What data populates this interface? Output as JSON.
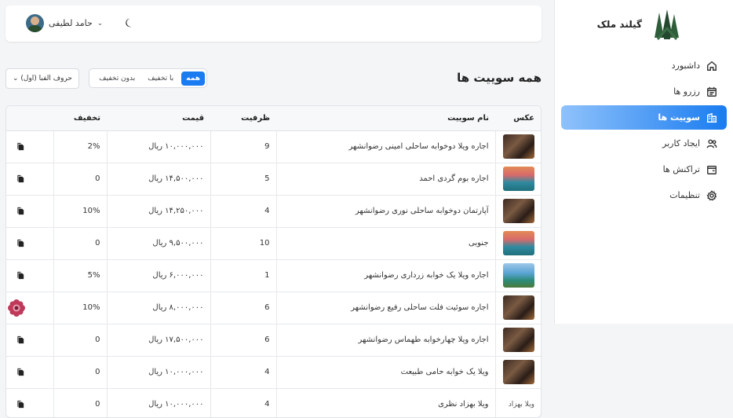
{
  "brand": {
    "name": "گیلند ملک"
  },
  "nav": [
    {
      "label": "داشبورد",
      "icon": "home-icon",
      "active": false
    },
    {
      "label": "رزرو ها",
      "icon": "calendar-icon",
      "active": false
    },
    {
      "label": "سوییت ها",
      "icon": "building-icon",
      "active": true
    },
    {
      "label": "ایجاد کاربر",
      "icon": "users-icon",
      "active": false
    },
    {
      "label": "تراکنش ها",
      "icon": "wallet-icon",
      "active": false
    },
    {
      "label": "تنظیمات",
      "icon": "gear-icon",
      "active": false
    }
  ],
  "header": {
    "user_name": "حامد لطیفی"
  },
  "page": {
    "title": "همه سوییت ها"
  },
  "filters": {
    "all": "همه",
    "with_discount": "با تخفیف",
    "no_discount": "بدون تخفیف"
  },
  "sort": {
    "selected": "حروف الفبا (اول)"
  },
  "table": {
    "headers": {
      "photo": "عکس",
      "name": "نام سوییت",
      "capacity": "ظرفیت",
      "price": "قیمت",
      "discount": "تخفیف"
    },
    "rows": [
      {
        "name": "اجاره ویلا دوخوابه ساحلی امینی رضوانشهر",
        "capacity": "9",
        "price": "۱۰,۰۰۰,۰۰۰ ریال",
        "discount": "2%",
        "img": "dark"
      },
      {
        "name": "اجاره بوم گردی احمد",
        "capacity": "5",
        "price": "۱۴,۵۰۰,۰۰۰ ریال",
        "discount": "0",
        "img": "sunset"
      },
      {
        "name": "آپارتمان دوخوابه ساحلی نوری رضوانشهر",
        "capacity": "4",
        "price": "۱۴,۲۵۰,۰۰۰ ریال",
        "discount": "10%",
        "img": "dark"
      },
      {
        "name": "جنوبی",
        "capacity": "10",
        "price": "۹,۵۰۰,۰۰۰ ریال",
        "discount": "0",
        "img": "sunset"
      },
      {
        "name": "اجاره ویلا یک خوابه زرداری رضوانشهر",
        "capacity": "1",
        "price": "۶,۰۰۰,۰۰۰ ریال",
        "discount": "5%",
        "img": "beach"
      },
      {
        "name": "اجاره سوئیت فلت ساحلی رفیع رضوانشهر",
        "capacity": "6",
        "price": "۸,۰۰۰,۰۰۰ ریال",
        "discount": "10%",
        "img": "dark"
      },
      {
        "name": "اجاره ویلا چهارخوابه طهماس رضوانشهر",
        "capacity": "6",
        "price": "۱۷,۵۰۰,۰۰۰ ریال",
        "discount": "0",
        "img": "dark"
      },
      {
        "name": "ویلا یک خوابه حامی طبیعت",
        "capacity": "4",
        "price": "۱۰,۰۰۰,۰۰۰ ریال",
        "discount": "0",
        "img": "dark"
      },
      {
        "name": "ویلا بهزاد نظری",
        "capacity": "4",
        "price": "۱۰,۰۰۰,۰۰۰ ریال",
        "discount": "0",
        "img": "broken",
        "alt": "ویلا بهزاد"
      }
    ]
  },
  "colors": {
    "accent": "#1a7cf0"
  }
}
